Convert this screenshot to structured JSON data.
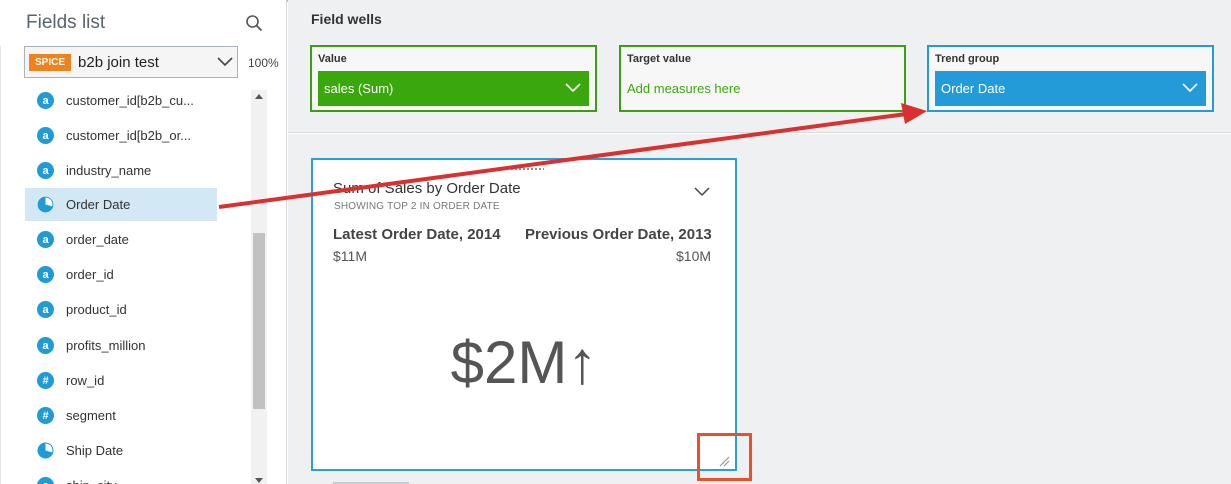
{
  "fields_panel": {
    "title": "Fields list",
    "dataset": {
      "badge": "SPICE",
      "name": "b2b join test"
    },
    "spice_percent": "100%",
    "fields": [
      {
        "label": "customer_id[b2b_cu...",
        "type": "string",
        "icon_text": "a"
      },
      {
        "label": "customer_id[b2b_or...",
        "type": "string",
        "icon_text": "a"
      },
      {
        "label": "industry_name",
        "type": "string",
        "icon_text": "a"
      },
      {
        "label": "Order Date",
        "type": "date",
        "icon_text": "",
        "selected": true
      },
      {
        "label": "order_date",
        "type": "string",
        "icon_text": "a"
      },
      {
        "label": "order_id",
        "type": "string",
        "icon_text": "a"
      },
      {
        "label": "product_id",
        "type": "string",
        "icon_text": "a"
      },
      {
        "label": "profits_million",
        "type": "string",
        "icon_text": "a"
      },
      {
        "label": "row_id",
        "type": "number",
        "icon_text": "#"
      },
      {
        "label": "segment",
        "type": "number",
        "icon_text": "#"
      },
      {
        "label": "Ship Date",
        "type": "date",
        "icon_text": ""
      },
      {
        "label": "ship_city",
        "type": "string",
        "icon_text": "a"
      }
    ]
  },
  "field_wells": {
    "title": "Field wells",
    "value": {
      "label": "Value",
      "field": "sales (Sum)"
    },
    "target": {
      "label": "Target value",
      "placeholder": "Add measures here"
    },
    "trend": {
      "label": "Trend group",
      "field": "Order Date"
    }
  },
  "visual": {
    "title": "Sum of Sales by Order Date",
    "subtitle": "SHOWING TOP 2 IN ORDER DATE",
    "latest_label": "Latest Order Date, 2014",
    "latest_value": "$11M",
    "previous_label": "Previous Order Date, 2013",
    "previous_value": "$10M",
    "kpi": "$2M↑"
  },
  "colors": {
    "accent_blue": "#239bd8",
    "accent_green": "#3aa80c",
    "spice_orange": "#f0821e",
    "annotation_red": "#d93030",
    "highlight_orange": "#e8522a"
  },
  "icons": {
    "search": "search-icon",
    "chevron": "chevron-down-icon",
    "date": "clock-icon",
    "resize": "resize-handle-icon"
  }
}
